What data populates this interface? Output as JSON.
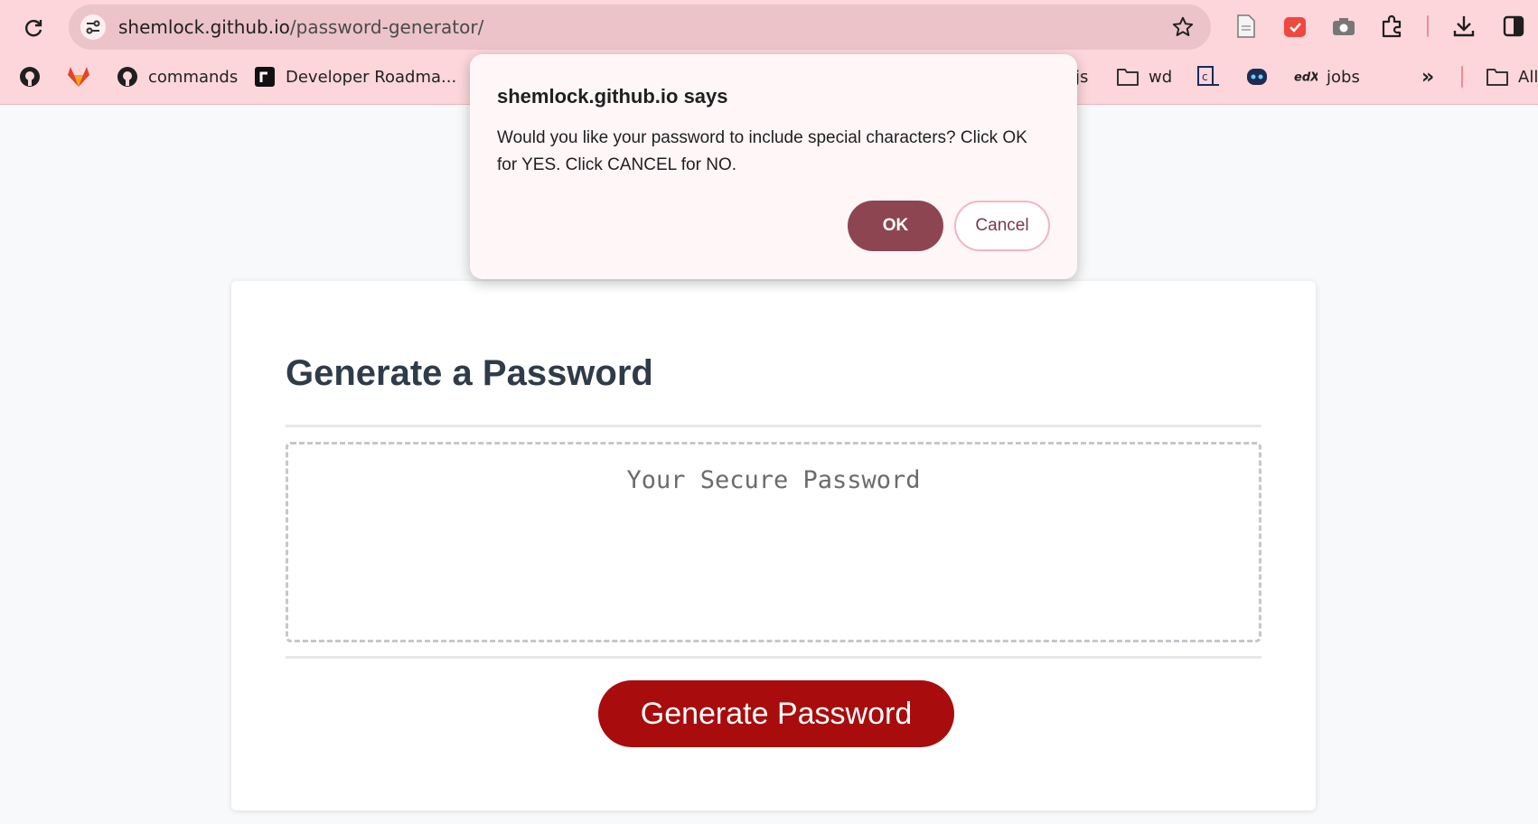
{
  "browser": {
    "url_host": "shemlock.github.io",
    "url_path": "/password-generator/",
    "bookmarks": [
      {
        "label": "",
        "icon": "github-icon"
      },
      {
        "label": "",
        "icon": "gitlab-icon"
      },
      {
        "label": "commands",
        "icon": "github-icon"
      },
      {
        "label": "Developer Roadma...",
        "icon": "roadmap-icon"
      },
      {
        "label": "js",
        "icon": "folder-icon"
      },
      {
        "label": "wd",
        "icon": "folder-icon"
      },
      {
        "label": "",
        "icon": "codecademy-icon"
      },
      {
        "label": "",
        "icon": "bot-icon"
      },
      {
        "label": "jobs",
        "icon": "edx-icon"
      },
      {
        "label": "All",
        "icon": "folder-icon"
      }
    ]
  },
  "dialog": {
    "title": "shemlock.github.io says",
    "message": "Would you like your password to include special characters? Click OK for YES. Click CANCEL for NO.",
    "ok_label": "OK",
    "cancel_label": "Cancel"
  },
  "page": {
    "heading": "Generate a Password",
    "password_placeholder": "Your Secure Password",
    "generate_label": "Generate Password"
  }
}
